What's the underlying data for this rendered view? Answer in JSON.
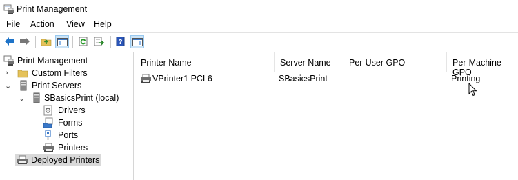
{
  "window": {
    "title": "Print Management",
    "icon": "print-management-icon"
  },
  "menu": [
    "File",
    "Action",
    "View",
    "Help"
  ],
  "toolbar": {
    "buttons": [
      "back-icon",
      "forward-icon",
      "up-folder-icon",
      "show-hide-tree-icon",
      "refresh-icon",
      "export-list-icon",
      "help-icon",
      "show-action-pane-icon"
    ],
    "active": [
      "show-hide-tree-icon",
      "show-action-pane-icon"
    ]
  },
  "tree": {
    "root": "Print Management",
    "custom_filters": "Custom Filters",
    "print_servers": "Print Servers",
    "server": "SBasicsPrint (local)",
    "drivers": "Drivers",
    "forms": "Forms",
    "ports": "Ports",
    "printers": "Printers",
    "deployed_printers": "Deployed Printers"
  },
  "list": {
    "columns": [
      "Printer Name",
      "Server Name",
      "Per-User GPO",
      "Per-Machine GPO"
    ],
    "rows": [
      {
        "printer": "VPrinter1 PCL6",
        "server": "SBasicsPrint",
        "per_user": "",
        "per_machine": "Printing"
      }
    ]
  },
  "colors": {
    "selection": "#d9d9d9",
    "toolbar_active": "#cce4f7",
    "back_arrow": "#1e73c8"
  }
}
